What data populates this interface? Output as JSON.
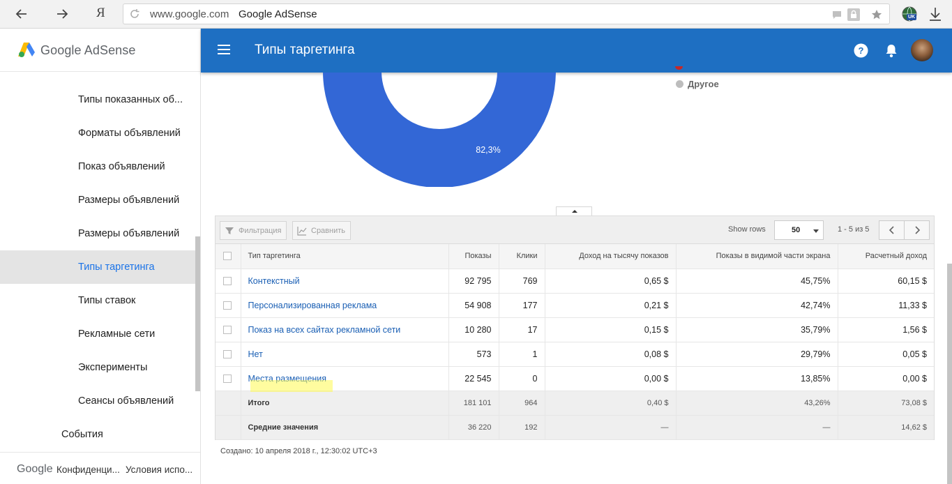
{
  "browser": {
    "back_icon": "arrow-left-icon",
    "forward_icon": "arrow-right-icon",
    "yandex_label": "Я",
    "domain": "www.google.com",
    "title": "Google AdSense",
    "translate_badge": "UK"
  },
  "sidebar": {
    "brand": "Google AdSense",
    "items": [
      {
        "label": "Типы показанных об..."
      },
      {
        "label": "Форматы объявлений"
      },
      {
        "label": "Показ объявлений"
      },
      {
        "label": "Размеры объявлений"
      },
      {
        "label": "Размеры объявлений"
      },
      {
        "label": "Типы таргетинга",
        "active": true
      },
      {
        "label": "Типы ставок"
      },
      {
        "label": "Рекламные сети"
      },
      {
        "label": "Эксперименты"
      },
      {
        "label": "Сеансы объявлений"
      }
    ],
    "parent_item": "События",
    "footer": {
      "brand": "Google",
      "privacy": "Конфиденци...",
      "terms": "Условия испо..."
    }
  },
  "header": {
    "title": "Типы таргетинга"
  },
  "donut": {
    "percent_label": "82,3%",
    "main_color": "#3367d6",
    "fraction_main": 0.823
  },
  "legend": [
    {
      "label": "Другое",
      "color": "#bdbdbd"
    }
  ],
  "toolbar": {
    "filter_label": "Фильтрация",
    "compare_label": "Сравнить",
    "show_rows_label": "Show rows",
    "rows_value": "50",
    "pager_text": "1 - 5 из 5"
  },
  "table": {
    "headers": [
      "Тип таргетинга",
      "Показы",
      "Клики",
      "Доход на тысячу показов",
      "Показы в видимой части экрана",
      "Расчетный доход"
    ],
    "rows": [
      [
        "Контекстный",
        "92 795",
        "769",
        "0,65 $",
        "45,75%",
        "60,15 $"
      ],
      [
        "Персонализированная реклама",
        "54 908",
        "177",
        "0,21 $",
        "42,74%",
        "11,33 $"
      ],
      [
        "Показ на всех сайтах рекламной сети",
        "10 280",
        "17",
        "0,15 $",
        "35,79%",
        "1,56 $"
      ],
      [
        "Нет",
        "573",
        "1",
        "0,08 $",
        "29,79%",
        "0,05 $"
      ],
      [
        "Места размещения",
        "22 545",
        "0",
        "0,00 $",
        "13,85%",
        "0,00 $"
      ]
    ],
    "total": [
      "Итого",
      "181 101",
      "964",
      "0,40 $",
      "43,26%",
      "73,08 $"
    ],
    "average": [
      "Средние значения",
      "36 220",
      "192",
      "—",
      "—",
      "14,62 $"
    ]
  },
  "footer_note": "Создано: 10 апреля 2018 г., 12:30:02 UTC+3"
}
